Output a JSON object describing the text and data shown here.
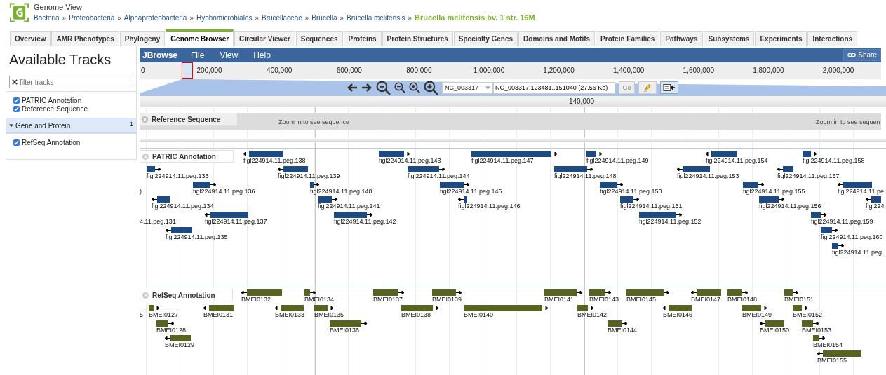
{
  "header": {
    "title": "Genome View",
    "separator": "»",
    "breadcrumbs": [
      "Bacteria",
      "Proteobacteria",
      "Alphaproteobacteria",
      "Hyphomicrobiales",
      "Brucellaceae",
      "Brucella",
      "Brucella melitensis"
    ],
    "current": "Brucella melitensis bv. 1 str. 16M"
  },
  "tabs": [
    {
      "label": "Overview",
      "selected": false
    },
    {
      "label": "AMR Phenotypes",
      "selected": false
    },
    {
      "label": "Phylogeny",
      "selected": false
    },
    {
      "label": "Genome Browser",
      "selected": true
    },
    {
      "label": "Circular Viewer",
      "selected": false
    },
    {
      "label": "Sequences",
      "selected": false
    },
    {
      "label": "Proteins",
      "selected": false
    },
    {
      "label": "Protein Structures",
      "selected": false
    },
    {
      "label": "Specialty Genes",
      "selected": false
    },
    {
      "label": "Domains and Motifs",
      "selected": false
    },
    {
      "label": "Protein Families",
      "selected": false
    },
    {
      "label": "Pathways",
      "selected": false
    },
    {
      "label": "Subsystems",
      "selected": false
    },
    {
      "label": "Experiments",
      "selected": false
    },
    {
      "label": "Interactions",
      "selected": false
    }
  ],
  "track_selector": {
    "title": "Available Tracks",
    "filter": {
      "placeholder": "filter tracks"
    },
    "tracks": [
      {
        "label": "PATRIC Annotation",
        "checked": true
      },
      {
        "label": "Reference Sequence",
        "checked": true
      }
    ],
    "categories": [
      {
        "label": "Gene and Protein",
        "count": "1",
        "expanded": true,
        "tracks": [
          {
            "label": "RefSeq Annotation",
            "checked": true
          }
        ]
      }
    ]
  },
  "browser": {
    "brand": "JBrowse",
    "menus": [
      "File",
      "View",
      "Help"
    ],
    "share": "Share",
    "overview_ticks": [
      "0",
      "200,000",
      "400,000",
      "600,000",
      "800,000",
      "1,000,000",
      "1,200,000",
      "1,400,000",
      "1,600,000",
      "1,800,000",
      "2,000,000"
    ],
    "ref_select": "NC_003317",
    "location": "NC_003317:123481..151040 (27.56 Kb)",
    "go": "Go",
    "detail_ticks": [
      "140,000"
    ],
    "tracks": [
      {
        "kind": "sequence",
        "label": "Reference Sequence",
        "messages": [
          "Zoom in to see sequence",
          "Zoom in to see sequen"
        ]
      },
      {
        "kind": "features",
        "label": "PATRIC Annotation",
        "color": "#1d4a80",
        "features": [
          {
            "label": "figl224914.11.peg.138",
            "reverse": true
          },
          {
            "label": "figl224914.11.peg.143",
            "reverse": false
          },
          {
            "label": "figl224914.11.peg.147",
            "reverse": false
          },
          {
            "label": "figl224914.11.peg.149",
            "reverse": false
          },
          {
            "label": "figl224914.11.peg.154",
            "reverse": true
          },
          {
            "label": "figl224914.11.peg.158",
            "reverse": false
          },
          {
            "label": "figl224914.11.peg.133",
            "reverse": false
          },
          {
            "label": "figl224914.11.peg.139",
            "reverse": true
          },
          {
            "label": "figl224914.11.peg.144",
            "reverse": false
          },
          {
            "label": "figl224914.11.peg.148",
            "reverse": false
          },
          {
            "label": "figl224914.11.peg.153",
            "reverse": true
          },
          {
            "label": "figl224914.11.peg.157",
            "reverse": true
          },
          {
            "label": ")"
          },
          {
            "label": "figl224914.11.peg.136",
            "reverse": false
          },
          {
            "label": "figl224914.11.peg.140",
            "reverse": false
          },
          {
            "label": "figl224914.11.peg.145",
            "reverse": false
          },
          {
            "label": "figl224914.11.peg.150",
            "reverse": false
          },
          {
            "label": "figl224914.11.peg.155",
            "reverse": false
          },
          {
            "label": "figl224914.11.pe",
            "reverse": true
          },
          {
            "label": "figl224914.11.peg.134",
            "reverse": true
          },
          {
            "label": "figl224914.11.peg.141",
            "reverse": false
          },
          {
            "label": "figl224914.11.peg.146",
            "reverse": true
          },
          {
            "label": "figl224914.11.peg.151",
            "reverse": false
          },
          {
            "label": "figl224914.11.peg.156",
            "reverse": false
          },
          {
            "label": "figl224",
            "reverse": true
          },
          {
            "label": "4.11.peg.131"
          },
          {
            "label": "figl224914.11.peg.137",
            "reverse": true
          },
          {
            "label": "figl224914.11.peg.142",
            "reverse": false
          },
          {
            "label": "figl224914.11.peg.152",
            "reverse": false
          },
          {
            "label": "figl224914.11.peg.159",
            "reverse": false
          },
          {
            "label": "figl224914.11.peg.135",
            "reverse": true
          },
          {
            "label": "figl224914.11.peg.160",
            "reverse": false
          },
          {
            "label": "figl224914.11.peg.",
            "reverse": false
          }
        ]
      },
      {
        "kind": "features",
        "label": "RefSeq Annotation",
        "color": "#56641f",
        "features": [
          {
            "label": "BMEI0132",
            "reverse": true
          },
          {
            "label": "BMEI0134",
            "reverse": false
          },
          {
            "label": "BMEI0137",
            "reverse": false
          },
          {
            "label": "BMEI0139",
            "reverse": false
          },
          {
            "label": "BMEI0141",
            "reverse": false
          },
          {
            "label": "BMEI0143",
            "reverse": false
          },
          {
            "label": "BMEI0145",
            "reverse": false
          },
          {
            "label": "BMEI0147",
            "reverse": true
          },
          {
            "label": "BMEI0148",
            "reverse": false
          },
          {
            "label": "BMEI0151",
            "reverse": false
          },
          {
            "label": "5"
          },
          {
            "label": "BMEI0127",
            "reverse": false
          },
          {
            "label": "BMEI0131",
            "reverse": true
          },
          {
            "label": "BMEI0133",
            "reverse": true
          },
          {
            "label": "BMEI0135",
            "reverse": false
          },
          {
            "label": "BMEI0138",
            "reverse": false
          },
          {
            "label": "BMEI0140",
            "reverse": false
          },
          {
            "label": "BMEI0142",
            "reverse": false
          },
          {
            "label": "BMEI0146",
            "reverse": true
          },
          {
            "label": "BMEI0149",
            "reverse": false
          },
          {
            "label": "BMEI0152",
            "reverse": false
          },
          {
            "label": "BMEI0128",
            "reverse": false
          },
          {
            "label": "BMEI0136",
            "reverse": false
          },
          {
            "label": "BMEI0144",
            "reverse": false
          },
          {
            "label": "BMEI0150",
            "reverse": true
          },
          {
            "label": "BMEI0153",
            "reverse": false
          },
          {
            "label": "BMEI0129",
            "reverse": true
          },
          {
            "label": "BMEI0154",
            "reverse": false
          },
          {
            "label": "BMEI0155",
            "reverse": true
          }
        ]
      }
    ]
  }
}
